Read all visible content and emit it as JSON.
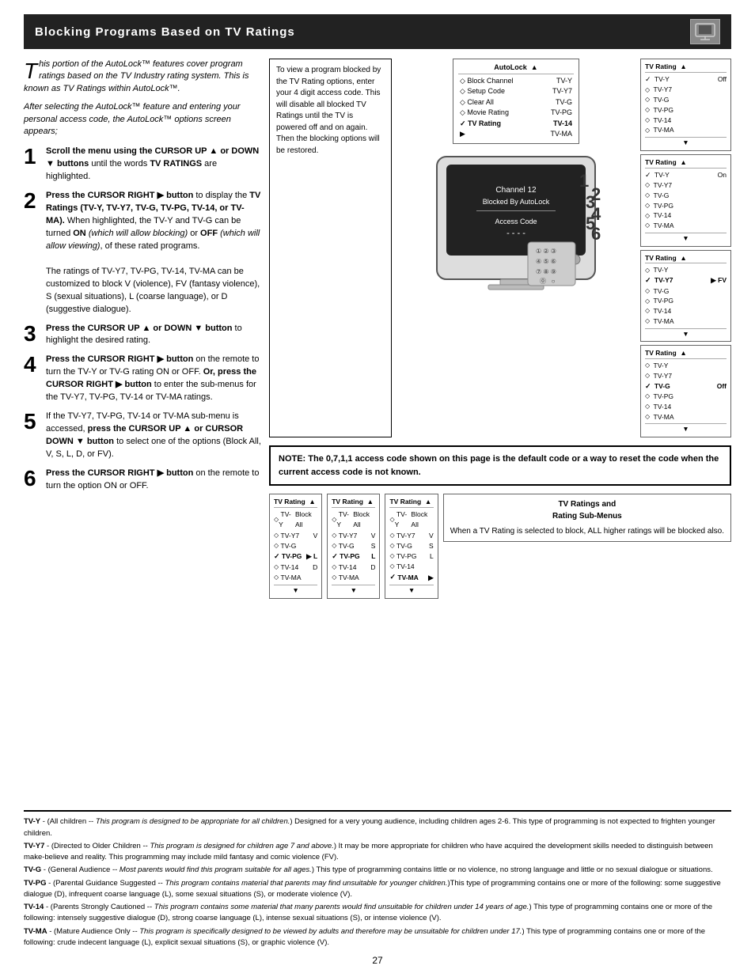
{
  "title": "Blocking Programs Based on TV Ratings",
  "title_icon": "tv-icon",
  "intro": {
    "dropcap": "T",
    "text1": "his portion of the AutoLock™ features cover program ratings based on the TV Industry rating system. This is known as TV Ratings within AutoLock™.",
    "text2": "After selecting the AutoLock™ feature and entering your personal access code, the AutoLock™ options screen appears;"
  },
  "steps": [
    {
      "num": "1",
      "text": "Scroll the menu using the CURSOR UP ▲ or DOWN ▼ buttons until the words TV RATINGS are highlighted."
    },
    {
      "num": "2",
      "text": "Press the CURSOR RIGHT ▶ button to display the TV Ratings (TV-Y, TV-Y7, TV-G, TV-PG, TV-14, or TV-MA). When highlighted, the TV-Y and TV-G can be turned ON (which will allow blocking) or OFF (which will allow viewing), of these rated programs.",
      "extra": "The ratings of TV-Y7, TV-PG, TV-14, TV-MA can be customized to block V (violence), FV (fantasy violence), S (sexual situations), L (coarse language), or D (suggestive dialogue)."
    },
    {
      "num": "3",
      "text": "Press the CURSOR UP ▲ or DOWN ▼ button to highlight the desired rating."
    },
    {
      "num": "4",
      "text": "Press the CURSOR RIGHT ▶ button on the remote to turn the TV-Y or TV-G rating ON or OFF. Or, press the CURSOR RIGHT ▶ button to enter the sub-menus for the TV-Y7, TV-PG, TV-14 or TV-MA ratings."
    },
    {
      "num": "5",
      "text": "If the TV-Y7, TV-PG, TV-14 or TV-MA sub-menu is accessed, press the CURSOR UP ▲ or CURSOR DOWN ▼ button to select one of the options (Block All, V, S, L, D, or FV)."
    },
    {
      "num": "6",
      "text": "Press the CURSOR RIGHT ▶ button on the remote to turn the option ON or OFF."
    }
  ],
  "info_box": {
    "text": "To view a program blocked by the TV Rating options, enter your 4 digit access code. This will disable all blocked TV Ratings until the TV is powered off and on again. Then the blocking options will be restored."
  },
  "autolock_menu": {
    "header": "AutoLock  ▲",
    "items": [
      {
        "bullet": "◇",
        "label": "Block Channel",
        "value": "TV-Y"
      },
      {
        "bullet": "◇",
        "label": "Setup Code",
        "value": "TV-Y7"
      },
      {
        "bullet": "◇",
        "label": "Clear All",
        "value": "TV-G"
      },
      {
        "bullet": "◇",
        "label": "Movie Rating",
        "value": "TV-PG"
      },
      {
        "bullet": "✓",
        "label": "TV Rating",
        "value": "TV-14",
        "selected": true
      },
      {
        "bullet": "▶",
        "label": "",
        "value": "TV-MA"
      }
    ]
  },
  "tv_screen": {
    "line1": "Channel 12",
    "line2": "Blocked By AutoLock",
    "label": "Access Code",
    "code": "- - - -"
  },
  "note_box": {
    "text": "NOTE: The 0,7,1,1 access code shown on this page is the default code or a way to reset the code when the current access code is not known."
  },
  "rating_panels_right": [
    {
      "header_left": "TV Rating  ▲",
      "items": [
        {
          "check": "✓",
          "label": "TV-Y",
          "value": "Off"
        },
        {
          "check": "◇",
          "label": "TV-Y7"
        },
        {
          "check": "◇",
          "label": "TV-G"
        },
        {
          "check": "◇",
          "label": "TV-PG"
        },
        {
          "check": "◇",
          "label": "TV-14"
        },
        {
          "check": "◇",
          "label": "TV-MA"
        }
      ]
    },
    {
      "header_left": "TV Rating  ▲",
      "items": [
        {
          "check": "✓",
          "label": "TV-Y",
          "value": "On"
        },
        {
          "check": "◇",
          "label": "TV-Y7"
        },
        {
          "check": "◇",
          "label": "TV-G"
        },
        {
          "check": "◇",
          "label": "TV-PG"
        },
        {
          "check": "◇",
          "label": "TV-14"
        },
        {
          "check": "◇",
          "label": "TV-MA"
        }
      ]
    },
    {
      "header_left": "TV Rating  ▲",
      "items": [
        {
          "check": "◇",
          "label": "TV-Y"
        },
        {
          "check": "✓",
          "label": "TV-Y7",
          "value": "▶ FV",
          "selected": true
        },
        {
          "check": "◇",
          "label": "TV-G"
        },
        {
          "check": "◇",
          "label": "TV-PG"
        },
        {
          "check": "◇",
          "label": "TV-14"
        },
        {
          "check": "◇",
          "label": "TV-MA"
        }
      ]
    },
    {
      "header_left": "TV Rating  ▲",
      "items": [
        {
          "check": "◇",
          "label": "TV-Y"
        },
        {
          "check": "◇",
          "label": "TV-Y7"
        },
        {
          "check": "✓",
          "label": "TV-G",
          "value": "Off"
        },
        {
          "check": "◇",
          "label": "TV-PG"
        },
        {
          "check": "◇",
          "label": "TV-14"
        },
        {
          "check": "◇",
          "label": "TV-MA"
        }
      ]
    }
  ],
  "sub_menus_bottom": [
    {
      "header": "TV Rating  ▲",
      "items": [
        {
          "check": "◇",
          "label": "TV-Y",
          "value": "Block All"
        },
        {
          "check": "◇",
          "label": "TV-Y7",
          "value": "V"
        },
        {
          "check": "◇",
          "label": "TV-G"
        },
        {
          "check": "✓",
          "label": "TV-PG",
          "value": "▶ L",
          "selected": true
        },
        {
          "check": "◇",
          "label": "TV-14",
          "value": "D"
        },
        {
          "check": "◇",
          "label": "TV-MA"
        }
      ]
    },
    {
      "header": "TV Rating  ▲",
      "items": [
        {
          "check": "◇",
          "label": "TV-Y",
          "value": "Block All"
        },
        {
          "check": "◇",
          "label": "TV-Y7",
          "value": "V"
        },
        {
          "check": "◇",
          "label": "TV-G",
          "value": "S"
        },
        {
          "check": "✓",
          "label": "TV-PG",
          "value": "L",
          "selected": true
        },
        {
          "check": "◇",
          "label": "TV-14",
          "value": "D"
        },
        {
          "check": "◇",
          "label": "TV-MA"
        }
      ]
    },
    {
      "header": "TV Rating  ▲",
      "items": [
        {
          "check": "◇",
          "label": "TV-Y",
          "value": "Block All"
        },
        {
          "check": "◇",
          "label": "TV-Y7",
          "value": "V"
        },
        {
          "check": "◇",
          "label": "TV-G",
          "value": "S"
        },
        {
          "check": "◇",
          "label": "TV-PG",
          "value": "L"
        },
        {
          "check": "◇",
          "label": "TV-14"
        },
        {
          "check": "✓",
          "label": "TV-MA",
          "value": "▶",
          "selected": true
        }
      ]
    }
  ],
  "tv_rating_caption": {
    "title": "TV Ratings and\nRating Sub-Menus",
    "text": "When a TV Rating is selected to block, ALL higher ratings will be blocked also."
  },
  "legend": [
    {
      "term": "TV-Y",
      "bold_part": "TV-Y",
      "text": " - (All children -- This program is designed to be appropriate for all children.) Designed for a very young audience, including children ages 2-6. This type of programming is not expected to frighten younger children."
    },
    {
      "term": "TV-Y7",
      "bold_part": "TV-Y7",
      "text": " - (Directed to Older Children -- This program is designed for children age 7 and above.) It may be more appropriate for children who have acquired the development skills needed to distinguish between make-believe and reality. This programming may include mild fantasy and comic violence (FV)."
    },
    {
      "term": "TV-G",
      "bold_part": "TV-G",
      "text": " - (General Audience -- Most parents would find this program suitable for all ages.) This type of programming contains little or no violence, no strong language and little or no sexual dialogue or situations."
    },
    {
      "term": "TV-PG",
      "bold_part": "TV-PG",
      "text": " - (Parental Guidance Suggested -- This program contains material that parents may find unsuitable for younger children.)This type of programming contains one or more of the following: some suggestive dialogue (D), infrequent coarse language (L), some sexual situations (S), or moderate violence (V)."
    },
    {
      "term": "TV-14",
      "bold_part": "TV-14",
      "text": " - (Parents Strongly Cautioned -- This program contains some material that many parents would find unsuitable for children under 14 years of age.) This type of programming contains one or more of the following: intensely suggestive dialogue (D), strong coarse language (L), intense sexual situations (S), or intense violence (V)."
    },
    {
      "term": "TV-MA",
      "bold_part": "TV-MA",
      "text": " - (Mature Audience Only -- This program is specifically designed to be viewed by adults and therefore may be unsuitable for children under 17.) This type of programming contains one or more of the following: crude indecent language (L), explicit sexual situations (S), or graphic violence (V)."
    }
  ],
  "page_number": "27"
}
